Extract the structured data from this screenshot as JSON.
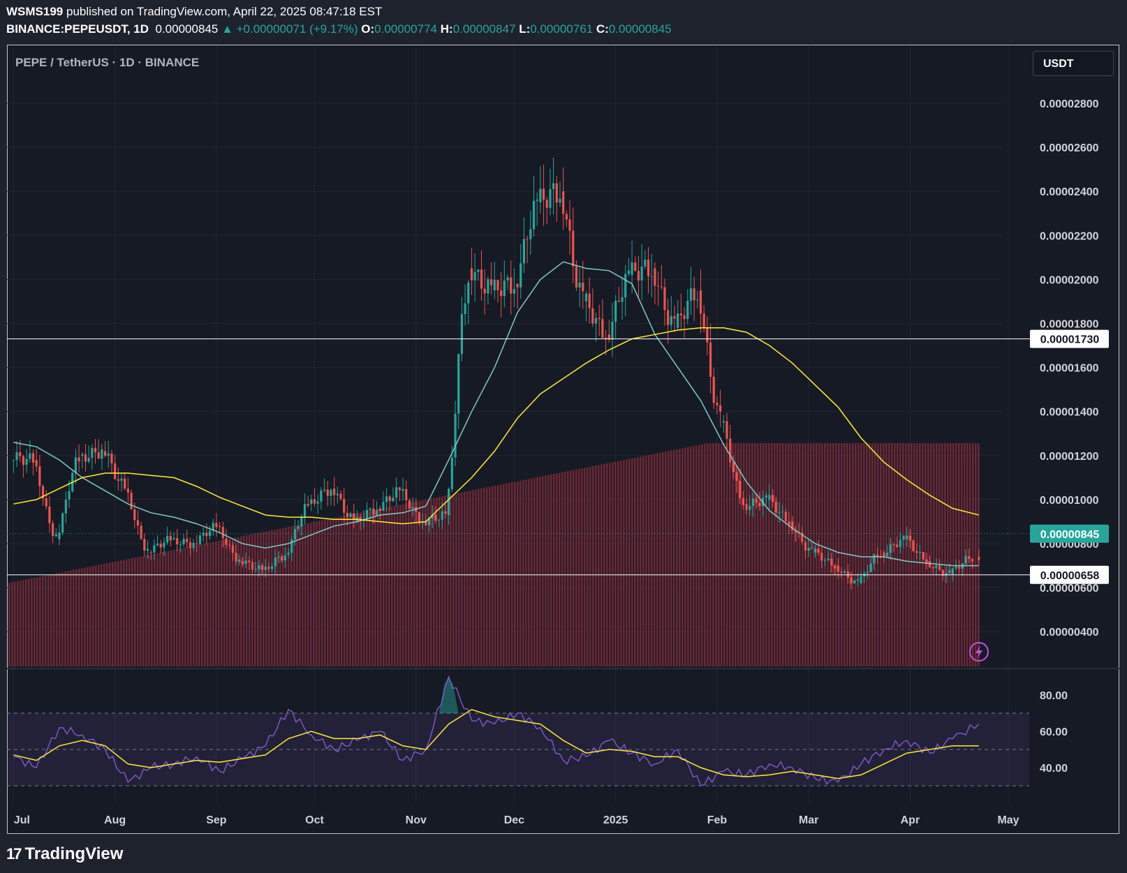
{
  "header": {
    "author": "WSMS199",
    "published_text": "published on TradingView.com, April 22, 2025 08:47:18 EST",
    "symbol": "BINANCE:PEPEUSDT, 1D",
    "last": "0.00000845",
    "change": "+0.00000071 (+9.17%)",
    "o_label": "O:",
    "o": "0.00000774",
    "h_label": "H:",
    "h": "0.00000847",
    "l_label": "L:",
    "l": "0.00000761",
    "c_label": "C:",
    "c": "0.00000845"
  },
  "chart_title": "PEPE / TetherUS · 1D · BINANCE",
  "currency_button": "USDT",
  "footer": {
    "brand": "TradingView"
  },
  "colors": {
    "up": "#26a69a",
    "down": "#ef5350",
    "ma_fast": "#80cbc4",
    "ma_slow": "#ffeb3b",
    "volume": "#7a2b3a",
    "rsi": "#7e57c2",
    "rsi_ma": "#ffeb3b"
  },
  "chart_data": [
    {
      "type": "candlestick",
      "title": "PEPE / TetherUS · 1D · BINANCE",
      "price_axis_labels": [
        "0.00002800",
        "0.00002600",
        "0.00002400",
        "0.00002200",
        "0.00002000",
        "0.00001800",
        "0.00001600",
        "0.00001400",
        "0.00001200",
        "0.00001000",
        "0.00000800",
        "0.00000600",
        "0.00000400"
      ],
      "ylim": [
        3e-06,
        2.9e-05
      ],
      "time_axis_labels": [
        "Jul",
        "Aug",
        "Sep",
        "Oct",
        "Nov",
        "Dec",
        "2025",
        "Feb",
        "Mar",
        "Apr",
        "May"
      ],
      "horizontal_lines": [
        {
          "value": 1.73e-05,
          "label": "0.00001730"
        },
        {
          "value": 6.58e-06,
          "label": "0.00000658"
        }
      ],
      "last_price": {
        "value": 8.45e-06,
        "label": "0.00000845"
      },
      "close_series": {
        "dates": [
          "2024-07-01",
          "2024-07-08",
          "2024-07-15",
          "2024-07-22",
          "2024-07-29",
          "2024-08-05",
          "2024-08-12",
          "2024-08-19",
          "2024-08-26",
          "2024-09-02",
          "2024-09-09",
          "2024-09-16",
          "2024-09-23",
          "2024-09-30",
          "2024-10-07",
          "2024-10-14",
          "2024-10-21",
          "2024-10-28",
          "2024-11-04",
          "2024-11-11",
          "2024-11-18",
          "2024-11-25",
          "2024-12-02",
          "2024-12-09",
          "2024-12-16",
          "2024-12-23",
          "2024-12-30",
          "2025-01-06",
          "2025-01-13",
          "2025-01-20",
          "2025-01-27",
          "2025-02-03",
          "2025-02-10",
          "2025-02-17",
          "2025-02-24",
          "2025-03-03",
          "2025-03-10",
          "2025-03-17",
          "2025-03-24",
          "2025-03-31",
          "2025-04-07",
          "2025-04-14",
          "2025-04-22"
        ],
        "close": [
          1.18e-05,
          8.2e-06,
          1.2e-05,
          1.22e-05,
          1.05e-05,
          7.6e-06,
          8.2e-06,
          8e-06,
          8.8e-06,
          7.2e-06,
          6.8e-06,
          7.5e-06,
          9.8e-06,
          1.05e-05,
          9e-06,
          9.6e-06,
          1.04e-05,
          9e-06,
          9.3e-06,
          2.05e-05,
          1.95e-05,
          1.98e-05,
          2.35e-05,
          2.4e-05,
          1.9e-05,
          1.75e-05,
          2.02e-05,
          2.05e-05,
          1.78e-05,
          1.95e-05,
          1.35e-05,
          9.8e-06,
          1e-05,
          9e-06,
          7.6e-06,
          7e-06,
          6.2e-06,
          7.6e-06,
          8.2e-06,
          7.2e-06,
          6.6e-06,
          7.4e-06,
          8.4e-06
        ],
        "ma_fast": [
          1.26e-05,
          1.24e-05,
          1.18e-05,
          1.1e-05,
          1.04e-05,
          9.8e-06,
          9.4e-06,
          9.2e-06,
          8.9e-06,
          8.5e-06,
          8e-06,
          7.8e-06,
          8e-06,
          8.4e-06,
          8.8e-06,
          9e-06,
          9.3e-06,
          9.4e-06,
          9.7e-06,
          1.18e-05,
          1.4e-05,
          1.6e-05,
          1.85e-05,
          2e-05,
          2.08e-05,
          2.05e-05,
          2.04e-05,
          1.98e-05,
          1.75e-05,
          1.6e-05,
          1.45e-05,
          1.25e-05,
          1.08e-05,
          9.5e-06,
          8.7e-06,
          8e-06,
          7.6e-06,
          7.4e-06,
          7.4e-06,
          7.2e-06,
          7.1e-06,
          7e-06,
          7e-06
        ],
        "ma_slow": [
          9.8e-06,
          1e-05,
          1.05e-05,
          1.1e-05,
          1.12e-05,
          1.12e-05,
          1.11e-05,
          1.1e-05,
          1.06e-05,
          1.01e-05,
          9.7e-06,
          9.3e-06,
          9.2e-06,
          9.2e-06,
          9.1e-06,
          9.1e-06,
          9e-06,
          8.9e-06,
          9e-06,
          1e-05,
          1.1e-05,
          1.22e-05,
          1.37e-05,
          1.48e-05,
          1.55e-05,
          1.62e-05,
          1.68e-05,
          1.73e-05,
          1.75e-05,
          1.77e-05,
          1.78e-05,
          1.78e-05,
          1.76e-05,
          1.7e-05,
          1.62e-05,
          1.52e-05,
          1.42e-05,
          1.28e-05,
          1.17e-05,
          1.09e-05,
          1.02e-05,
          9.6e-06,
          9.3e-06
        ]
      }
    },
    {
      "type": "line",
      "title": "RSI",
      "ylim": [
        24,
        92
      ],
      "axis_labels": [
        "80.00",
        "60.00",
        "40.00"
      ],
      "bands": [
        30,
        50,
        70
      ],
      "rsi": [
        46,
        40,
        62,
        58,
        50,
        32,
        40,
        42,
        46,
        38,
        45,
        52,
        72,
        58,
        50,
        55,
        60,
        44,
        50,
        90,
        66,
        64,
        70,
        62,
        44,
        46,
        55,
        48,
        42,
        50,
        30,
        38,
        36,
        42,
        40,
        34,
        32,
        42,
        50,
        55,
        48,
        56,
        64
      ],
      "rsi_ma": [
        47,
        44,
        52,
        55,
        52,
        42,
        40,
        42,
        44,
        43,
        45,
        47,
        56,
        60,
        56,
        56,
        58,
        52,
        50,
        64,
        72,
        68,
        66,
        64,
        55,
        48,
        50,
        49,
        46,
        46,
        40,
        36,
        35,
        36,
        38,
        36,
        34,
        36,
        42,
        48,
        50,
        52,
        52
      ]
    }
  ]
}
